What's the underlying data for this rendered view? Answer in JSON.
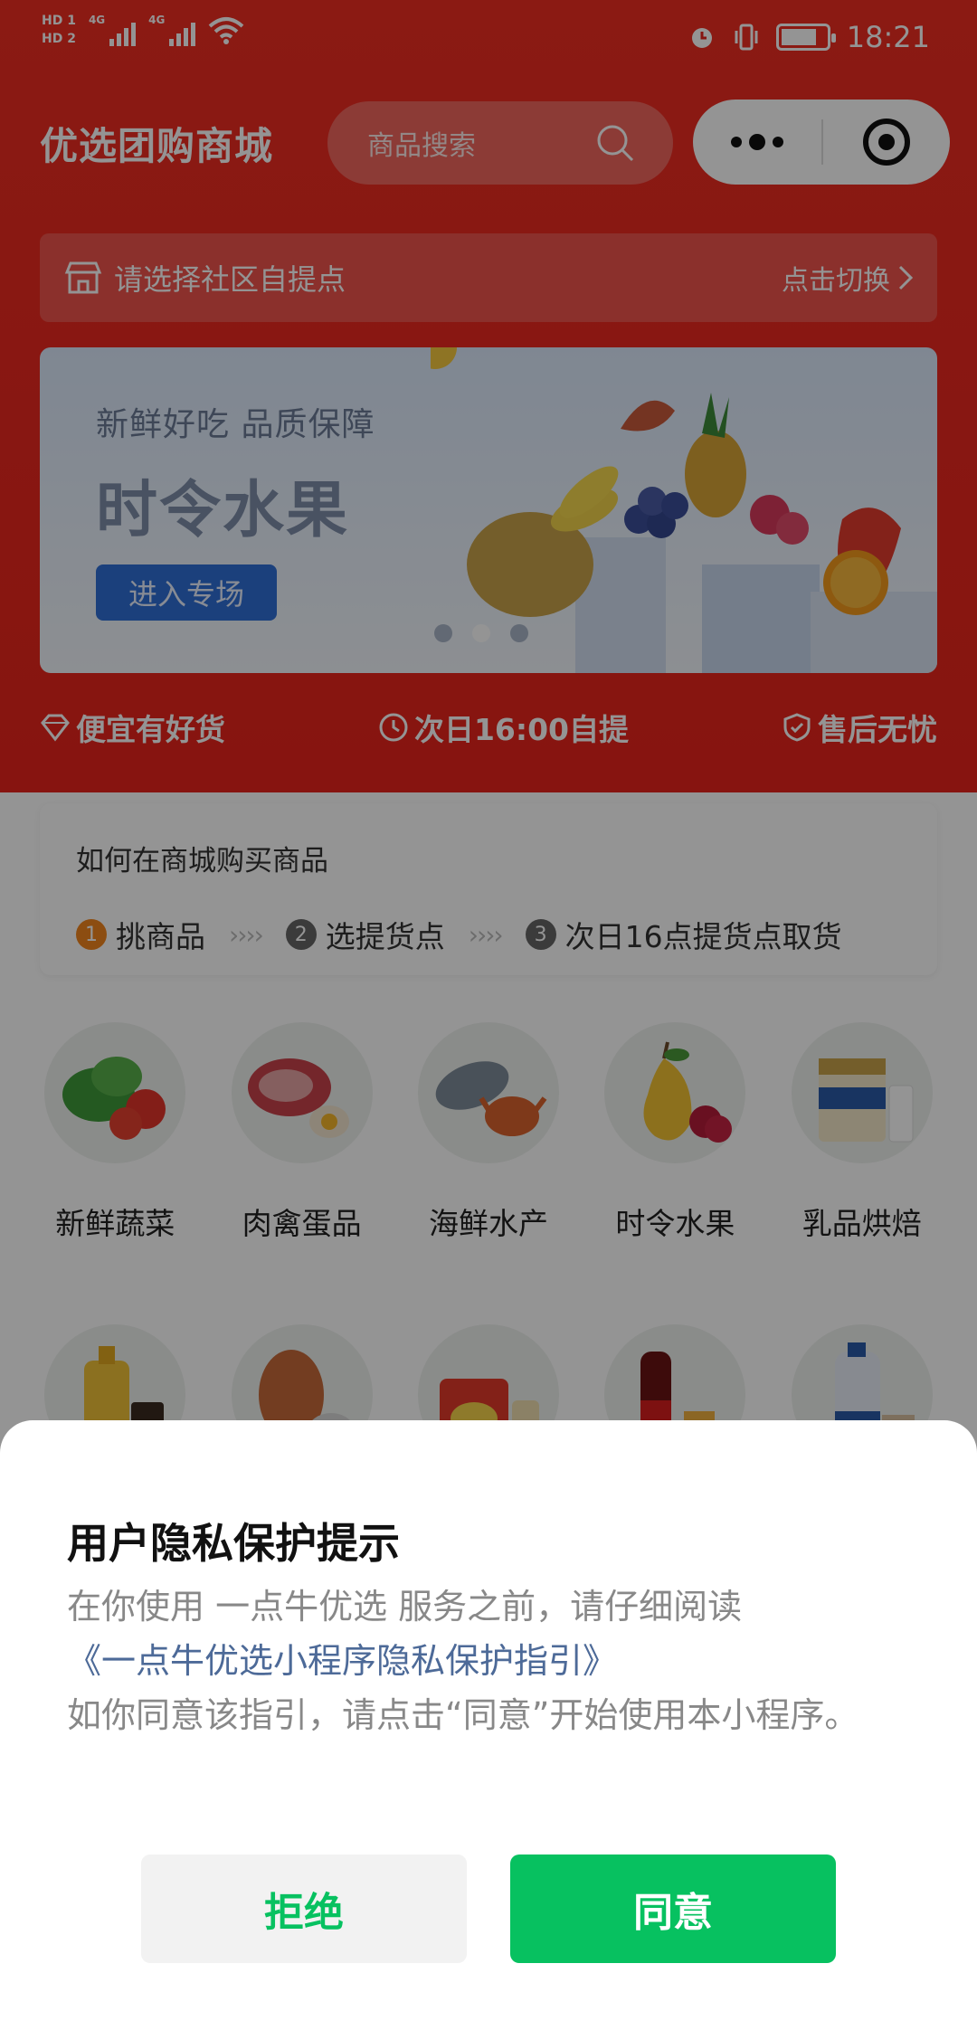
{
  "status_bar": {
    "hd1": "HD 1",
    "hd2": "HD 2",
    "net1": "4G",
    "net2": "4G",
    "time": "18:21"
  },
  "header": {
    "title": "优选团购商城",
    "search_placeholder": "商品搜索"
  },
  "pickup": {
    "label": "请选择社区自提点",
    "switch_label": "点击切换"
  },
  "banner": {
    "subtitle": "新鲜好吃  品质保障",
    "title": "时令水果",
    "button": "进入专场",
    "page_count": 3,
    "active_page": 2
  },
  "features": [
    "便宜有好货",
    "次日16:00自提",
    "售后无忧"
  ],
  "howto": {
    "question": "如何在商城购买商品",
    "steps": [
      {
        "num": "1",
        "label": "挑商品"
      },
      {
        "num": "2",
        "label": "选提货点"
      },
      {
        "num": "3",
        "label": "次日16点提货点取货"
      }
    ]
  },
  "categories": [
    {
      "label": "新鲜蔬菜",
      "icon": "vegetables-icon"
    },
    {
      "label": "肉禽蛋品",
      "icon": "meat-eggs-icon"
    },
    {
      "label": "海鲜水产",
      "icon": "seafood-icon"
    },
    {
      "label": "时令水果",
      "icon": "fruit-icon"
    },
    {
      "label": "乳品烘焙",
      "icon": "dairy-icon"
    }
  ],
  "categories_row2_icons": [
    "cooking-oil-icon",
    "poultry-icon",
    "snacks-icon",
    "drinks-icon",
    "household-icon"
  ],
  "privacy_dialog": {
    "title": "用户隐私保护提示",
    "line1": "在你使用 一点牛优选 服务之前，请仔细阅读",
    "link": "《一点牛优选小程序隐私保护指引》",
    "line2": "如你同意该指引，请点击“同意”开始使用本小程序。",
    "reject": "拒绝",
    "agree": "同意"
  },
  "colors": {
    "brand_red": "#e8241c",
    "accent_green": "#07c160",
    "link_blue": "#4d6a98",
    "banner_button": "#2f6fd6"
  }
}
